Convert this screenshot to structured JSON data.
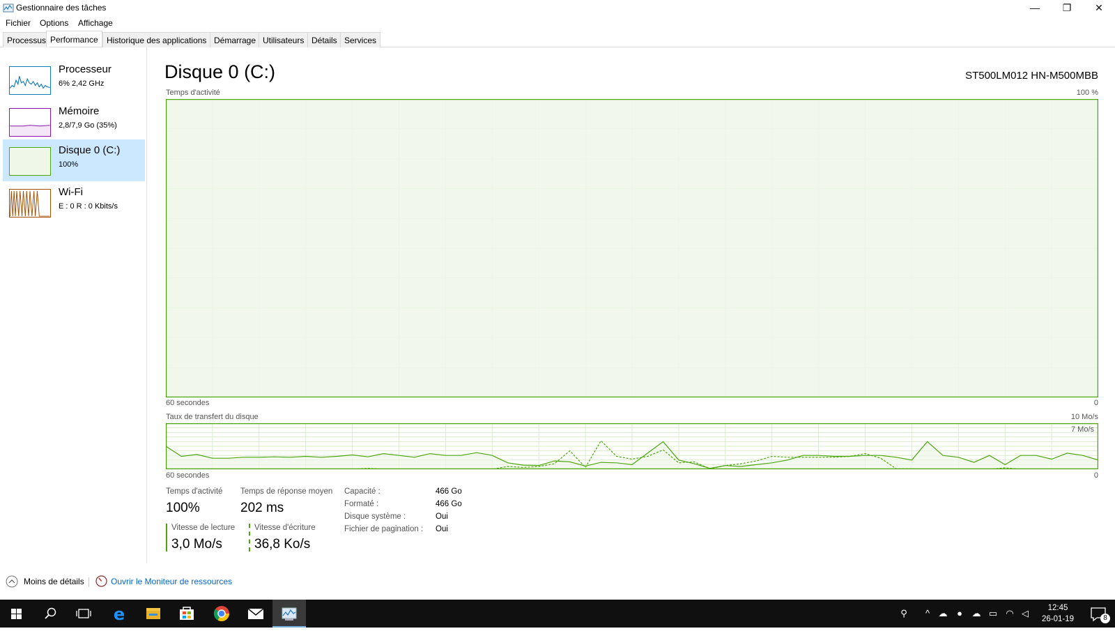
{
  "window": {
    "title": "Gestionnaire des tâches",
    "controls": {
      "minimize": "—",
      "maximize": "❐",
      "close": "✕"
    }
  },
  "menu": [
    "Fichier",
    "Options",
    "Affichage"
  ],
  "tabs": [
    "Processus",
    "Performance",
    "Historique des applications",
    "Démarrage",
    "Utilisateurs",
    "Détails",
    "Services"
  ],
  "sidebar": [
    {
      "title": "Processeur",
      "sub": "6%  2,42 GHz",
      "color": "#117dbb"
    },
    {
      "title": "Mémoire",
      "sub": "2,8/7,9 Go (35%)",
      "color": "#8b12ae"
    },
    {
      "title": "Disque 0 (C:)",
      "sub": "100%",
      "color": "#4da60c",
      "selected": true
    },
    {
      "title": "Wi-Fi",
      "sub": "E : 0  R : 0 Kbits/s",
      "color": "#a74f01"
    }
  ],
  "main": {
    "title": "Disque 0 (C:)",
    "model": "ST500LM012 HN-M500MBB",
    "activity_chart": {
      "label": "Temps d'activité",
      "max": "100 %",
      "time": "60 secondes",
      "min": "0"
    },
    "transfer_chart": {
      "label": "Taux de transfert du disque",
      "max": "10 Mo/s",
      "mid": "7 Mo/s",
      "time": "60 secondes",
      "min": "0"
    }
  },
  "stats": {
    "activity_label": "Temps d'activité",
    "activity_value": "100%",
    "response_label": "Temps de réponse moyen",
    "response_value": "202 ms",
    "read_label": "Vitesse de lecture",
    "read_value": "3,0 Mo/s",
    "write_label": "Vitesse d'écriture",
    "write_value": "36,8 Ko/s"
  },
  "properties": [
    {
      "label": "Capacité :",
      "value": "466 Go"
    },
    {
      "label": "Formaté :",
      "value": "466 Go"
    },
    {
      "label": "Disque système :",
      "value": "Oui"
    },
    {
      "label": "Fichier de pagination :",
      "value": "Oui"
    }
  ],
  "footer": {
    "less_details": "Moins de détails",
    "resource_monitor": "Ouvrir le Moniteur de ressources"
  },
  "taskbar": {
    "apps": [
      "start-icon",
      "search-icon",
      "task-view-icon",
      "edge-icon",
      "explorer-icon",
      "store-icon",
      "chrome-icon",
      "mail-icon",
      "task-manager-icon"
    ],
    "time": "12:45",
    "date": "26-01-19",
    "notifications": "8"
  },
  "chart_data": [
    {
      "type": "area",
      "title": "Temps d'activité",
      "xlabel": "60 secondes",
      "ylim": [
        0,
        100
      ],
      "series": [
        {
          "values": [
            100,
            100,
            100,
            100,
            100,
            100,
            100,
            100,
            100,
            100,
            100,
            100,
            100,
            100,
            100,
            100,
            100,
            100,
            100,
            100,
            100,
            100,
            100,
            100,
            100,
            100,
            100,
            100,
            100,
            100,
            100,
            100,
            100,
            100,
            100,
            100,
            100,
            100,
            100,
            100,
            100,
            100,
            100,
            100,
            100,
            100,
            100,
            100,
            100,
            100,
            100,
            100,
            100,
            100,
            100,
            100,
            100,
            100,
            100,
            100
          ]
        }
      ]
    },
    {
      "type": "line",
      "title": "Taux de transfert du disque",
      "xlabel": "60 secondes",
      "ylim": [
        0,
        10
      ],
      "series": [
        {
          "values": [
            5.0,
            2.8,
            3.2,
            2.4,
            2.4,
            2.6,
            2.6,
            2.7,
            2.6,
            2.8,
            2.6,
            2.8,
            3.1,
            2.7,
            3.4,
            3.0,
            2.6,
            3.4,
            3.0,
            3.0,
            3.6,
            3.0,
            1.4,
            0.9,
            0.8,
            1.8,
            1.6,
            0.7,
            1.5,
            1.4,
            1.0,
            3.5,
            6.0,
            2.0,
            1.2,
            0.2,
            0.8,
            0.6,
            1.0,
            1.4,
            2.0,
            3.0,
            3.0,
            2.8,
            2.8,
            3.0,
            3.0,
            2.6,
            2.0,
            6.0,
            3.0,
            2.6,
            1.5,
            3.0,
            1.0,
            3.0,
            3.0,
            2.2,
            3.5,
            3.0,
            2.0
          ]
        },
        {
          "values": [
            0,
            0,
            0,
            0,
            0,
            0,
            0,
            0,
            0,
            0,
            0,
            0,
            0,
            0.2,
            0,
            0,
            0,
            0,
            0,
            0,
            0,
            0,
            0.6,
            0.4,
            0.6,
            1.2,
            4.0,
            0.4,
            6.2,
            2.8,
            2.2,
            2.8,
            4.2,
            1.4,
            1.6,
            0.1,
            0.8,
            1.2,
            1.8,
            2.8,
            2.6,
            2.6,
            2.6,
            2.6,
            2.8,
            3.4,
            2.4,
            0.1,
            0.1,
            0,
            0,
            0,
            0,
            0,
            0.3,
            0,
            0,
            0,
            0,
            0,
            0
          ]
        }
      ]
    }
  ]
}
